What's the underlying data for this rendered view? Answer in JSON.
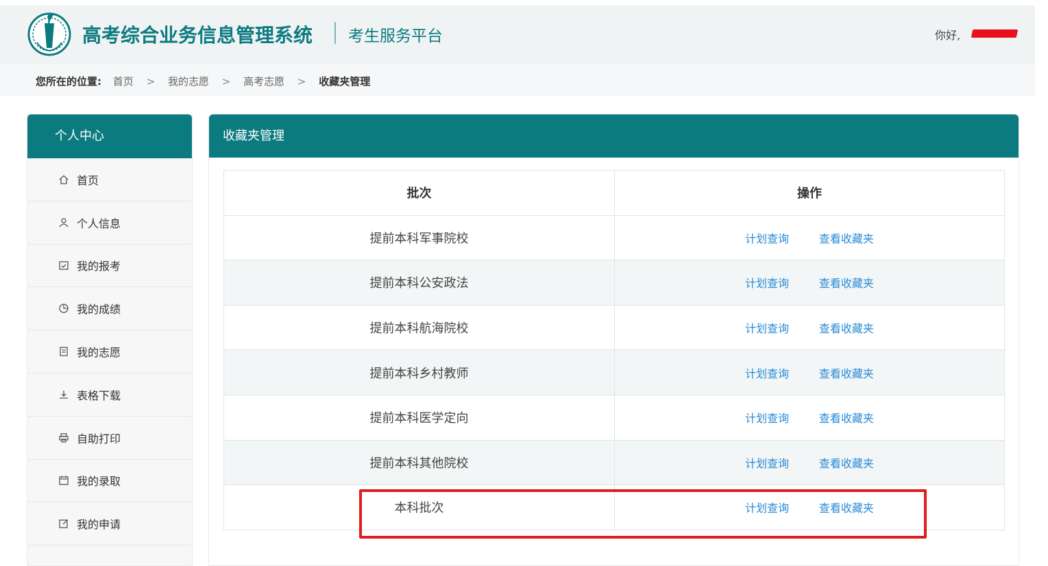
{
  "header": {
    "system_title": "高考综合业务信息管理系统",
    "sub_title": "考生服务平台",
    "greeting": "你好,"
  },
  "breadcrumb": {
    "lead": "您所在的位置:",
    "items": [
      "首页",
      "我的志愿",
      "高考志愿",
      "收藏夹管理"
    ],
    "separator": ">"
  },
  "sidebar": {
    "title": "个人中心",
    "items": [
      {
        "label": "首页",
        "icon": "home-icon"
      },
      {
        "label": "个人信息",
        "icon": "user-icon"
      },
      {
        "label": "我的报考",
        "icon": "calendar-check-icon"
      },
      {
        "label": "我的成绩",
        "icon": "pie-chart-icon"
      },
      {
        "label": "我的志愿",
        "icon": "document-icon"
      },
      {
        "label": "表格下载",
        "icon": "download-icon"
      },
      {
        "label": "自助打印",
        "icon": "printer-icon"
      },
      {
        "label": "我的录取",
        "icon": "calendar-icon"
      },
      {
        "label": "我的申请",
        "icon": "edit-icon"
      }
    ]
  },
  "panel": {
    "title": "收藏夹管理",
    "table": {
      "headers": [
        "批次",
        "操作"
      ],
      "rows": [
        {
          "batch": "提前本科军事院校",
          "actions": [
            "计划查询",
            "查看收藏夹"
          ]
        },
        {
          "batch": "提前本科公安政法",
          "actions": [
            "计划查询",
            "查看收藏夹"
          ]
        },
        {
          "batch": "提前本科航海院校",
          "actions": [
            "计划查询",
            "查看收藏夹"
          ]
        },
        {
          "batch": "提前本科乡村教师",
          "actions": [
            "计划查询",
            "查看收藏夹"
          ]
        },
        {
          "batch": "提前本科医学定向",
          "actions": [
            "计划查询",
            "查看收藏夹"
          ]
        },
        {
          "batch": "提前本科其他院校",
          "actions": [
            "计划查询",
            "查看收藏夹"
          ]
        },
        {
          "batch": "本科批次",
          "actions": [
            "计划查询",
            "查看收藏夹"
          ]
        }
      ]
    }
  },
  "colors": {
    "brand": "#0c7b80",
    "link": "#2a8bd6",
    "highlight": "#e01c1c",
    "redaction": "#e8101b"
  }
}
